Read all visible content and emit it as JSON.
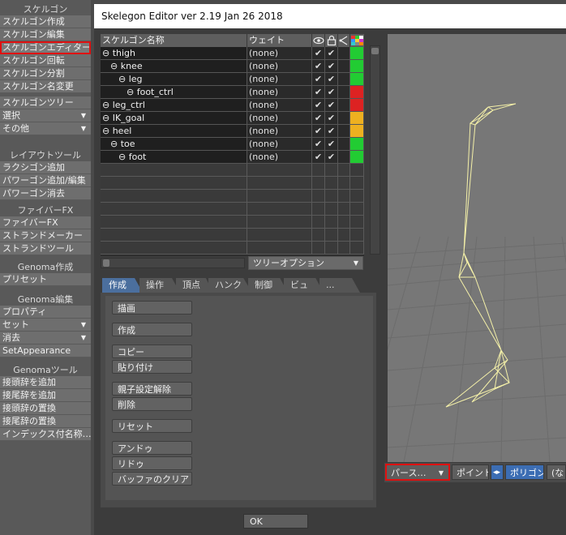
{
  "left_menu": {
    "groups": [
      {
        "title": "スケルゴン",
        "items": [
          {
            "label": "スケルゴン作成"
          },
          {
            "label": "スケルゴン編集"
          },
          {
            "label": "スケルゴンエディター",
            "highlight": true
          },
          {
            "label": "スケルゴン回転"
          },
          {
            "label": "スケルゴン分割"
          },
          {
            "label": "スケルゴン名変更"
          },
          {
            "label": "スケルゴンツリー"
          },
          {
            "label": "選択",
            "dropdown": true
          },
          {
            "label": "その他",
            "dropdown": true
          }
        ]
      },
      {
        "title": "レイアウトツール",
        "items": [
          {
            "label": "ラクシゴン追加"
          },
          {
            "label": "パワーゴン追加/編集"
          },
          {
            "label": "パワーゴン消去"
          }
        ]
      },
      {
        "title": "ファイバーFX",
        "items": [
          {
            "label": "ファイバーFX"
          },
          {
            "label": "ストランドメーカー"
          },
          {
            "label": "ストランドツール"
          }
        ]
      },
      {
        "title": "Genoma作成",
        "items": [
          {
            "label": "プリセット"
          }
        ]
      },
      {
        "title": "Genoma編集",
        "items": [
          {
            "label": "プロパティ"
          },
          {
            "label": "セット",
            "dropdown": true
          },
          {
            "label": "消去",
            "dropdown": true
          },
          {
            "label": "SetAppearance"
          }
        ]
      },
      {
        "title": "Genomaツール",
        "items": [
          {
            "label": "接頭辞を追加"
          },
          {
            "label": "接尾辞を追加"
          },
          {
            "label": "接頭辞の置換"
          },
          {
            "label": "接尾辞の置換"
          },
          {
            "label": "インデックス付名称…"
          }
        ]
      }
    ]
  },
  "window": {
    "title": "Skelegon Editor ver 2.19 Jan 26 2018"
  },
  "tree": {
    "headers": {
      "name": "スケルゴン名称",
      "weight": "ウェイト"
    },
    "header_icons": [
      "eye-icon",
      "lock-icon",
      "hierarchy-icon",
      "color-palette-icon"
    ],
    "rows": [
      {
        "name": "⊖ thigh",
        "indent": 0,
        "weight": "(none)",
        "v1": "✔",
        "v2": "✔",
        "color": "#22cc33"
      },
      {
        "name": "⊖ knee",
        "indent": 1,
        "weight": "(none)",
        "v1": "✔",
        "v2": "✔",
        "color": "#22cc33"
      },
      {
        "name": "⊖ leg",
        "indent": 2,
        "weight": "(none)",
        "v1": "✔",
        "v2": "✔",
        "color": "#22cc33"
      },
      {
        "name": "⊖ foot_ctrl",
        "indent": 3,
        "weight": "(none)",
        "v1": "✔",
        "v2": "✔",
        "color": "#dd2222"
      },
      {
        "name": "⊖ leg_ctrl",
        "indent": 0,
        "weight": "(none)",
        "v1": "✔",
        "v2": "✔",
        "color": "#dd2222"
      },
      {
        "name": "⊖ IK_goal",
        "indent": 0,
        "weight": "(none)",
        "v1": "✔",
        "v2": "✔",
        "color": "#eeb020"
      },
      {
        "name": "⊖ heel",
        "indent": 0,
        "weight": "(none)",
        "v1": "✔",
        "v2": "✔",
        "color": "#eeb020"
      },
      {
        "name": "⊖ toe",
        "indent": 1,
        "weight": "(none)",
        "v1": "✔",
        "v2": "✔",
        "color": "#22cc33"
      },
      {
        "name": "⊖ foot",
        "indent": 2,
        "weight": "(none)",
        "v1": "✔",
        "v2": "✔",
        "color": "#22cc33"
      }
    ],
    "empty_rows": 7,
    "tree_options_label": "ツリーオプション"
  },
  "tabs": [
    "作成",
    "操作",
    "頂点",
    "ハンク",
    "制御",
    "ビュー",
    "..."
  ],
  "active_tab": 0,
  "actions": [
    "描画",
    "作成",
    "コピー",
    "貼り付け",
    "親子設定解除",
    "削除",
    "リセット",
    "アンドゥ",
    "リドゥ",
    "バッファのクリア"
  ],
  "viewport_bar": {
    "view_mode": "パース…",
    "point_label": "ポイント",
    "polygon_label": "ポリゴン",
    "none_label": "(なし"
  },
  "ok_label": "OK",
  "colors": {
    "accent_blue": "#3c6db3",
    "highlight_red": "#e01010",
    "wire": "#f4f0a8"
  }
}
